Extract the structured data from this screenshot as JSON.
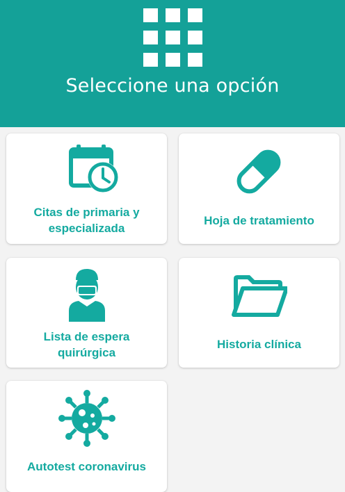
{
  "header": {
    "title": "Seleccione una opción",
    "menu_icon": "apps-grid-icon"
  },
  "colors": {
    "primary": "#14a198",
    "accent_text": "#14aaa0",
    "background": "#f3f3f3",
    "card": "#ffffff"
  },
  "options": [
    {
      "label": "Citas de primaria y\nespecializada",
      "icon": "calendar-clock-icon"
    },
    {
      "label": "Hoja de tratamiento",
      "icon": "pill-capsule-icon"
    },
    {
      "label": "Lista de espera\nquirúrgica",
      "icon": "surgeon-icon"
    },
    {
      "label": "Historia clínica",
      "icon": "folder-open-icon"
    },
    {
      "label": "Autotest coronavirus",
      "icon": "virus-icon"
    }
  ]
}
